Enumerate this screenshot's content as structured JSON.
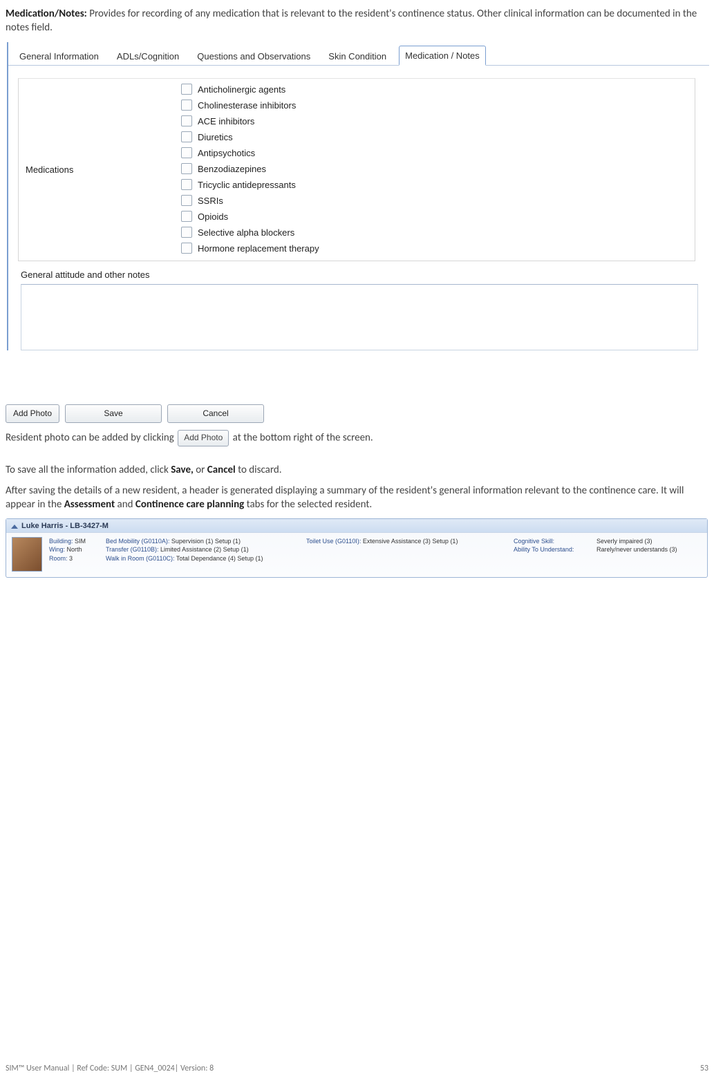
{
  "intro": {
    "heading": "Medication/Notes:",
    "body": " Provides for recording of any medication that is relevant to the resident's continence status. Other clinical information can be documented in the notes field."
  },
  "tabs": {
    "items": [
      {
        "label": "General Information"
      },
      {
        "label": "ADLs/Cognition"
      },
      {
        "label": "Questions and Observations"
      },
      {
        "label": "Skin Condition"
      },
      {
        "label": "Medication / Notes"
      }
    ],
    "active_index": 4
  },
  "medications": {
    "group_label": "Medications",
    "items": [
      {
        "label": "Anticholinergic agents"
      },
      {
        "label": "Cholinesterase inhibitors"
      },
      {
        "label": "ACE inhibitors"
      },
      {
        "label": "Diuretics"
      },
      {
        "label": "Antipsychotics"
      },
      {
        "label": "Benzodiazepines"
      },
      {
        "label": "Tricyclic antidepressants"
      },
      {
        "label": "SSRIs"
      },
      {
        "label": "Opioids"
      },
      {
        "label": "Selective alpha blockers"
      },
      {
        "label": "Hormone replacement therapy"
      }
    ]
  },
  "notes_label": "General attitude and other notes",
  "button_row": {
    "add_photo": "Add Photo",
    "save": "Save",
    "cancel": "Cancel"
  },
  "photo_sentence": {
    "pre": "Resident photo can be added by clicking ",
    "btn": "Add Photo",
    "post": " at the bottom right of the screen."
  },
  "sentence_save": {
    "pre": "To save all the information added, click ",
    "b1": "Save,",
    "mid": " or ",
    "b2": "Cancel",
    "post": " to discard."
  },
  "sentence_after": {
    "t1": "After saving the details of a new resident, a header is generated displaying a summary of the resident's general information relevant to the continence care. It will appear in the ",
    "b1": "Assessment",
    "t2": " and ",
    "b2": "Continence care planning",
    "t3": " tabs for the selected resident."
  },
  "summary": {
    "title": "Luke Harris  -  LB-3427-M",
    "col1": {
      "k1": "Building:",
      "v1": "SIM",
      "k2": "Wing:",
      "v2": "North",
      "k3": "Room:",
      "v3": "3"
    },
    "col2": {
      "l1k": "Bed Mobility (G0110A):",
      "l1v": "Supervision (1) Setup (1)",
      "l2k": "Transfer (G0110B):",
      "l2v": "Limited Assistance (2) Setup (1)",
      "l3k": "Walk in Room (G0110C):",
      "l3v": "Total Dependance (4) Setup (1)"
    },
    "col3": {
      "l1k": "Toilet Use (G0110I):",
      "l1v": " Extensive Assistance (3) Setup (1)"
    },
    "col4": {
      "l1k": "Cognitive Skill:",
      "l1v": "Severly impaired (3)",
      "l2k": "Ability To Understand:",
      "l2v": "Rarely/never understands (3)"
    }
  },
  "footer": {
    "left": "SIM™ User Manual | Ref Code: SUM | GEN4_0024| Version: 8",
    "right": "53"
  }
}
